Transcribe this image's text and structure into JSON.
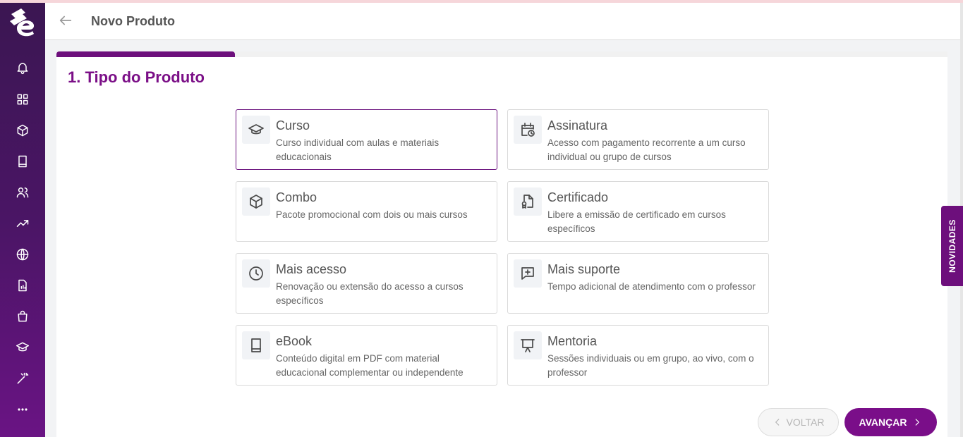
{
  "app": {
    "colors": {
      "accent": "#7a0e89",
      "sidebar": "#4a1565",
      "selected_border": "#6d1680"
    }
  },
  "sidebar": {
    "items": [
      {
        "icon": "bell-icon"
      },
      {
        "icon": "grid-icon"
      },
      {
        "icon": "box-icon"
      },
      {
        "icon": "book-icon"
      },
      {
        "icon": "users-icon"
      },
      {
        "icon": "trending-up-icon"
      },
      {
        "icon": "globe-icon"
      },
      {
        "icon": "report-icon"
      },
      {
        "icon": "shopping-bag-icon"
      },
      {
        "icon": "graduation-cap-icon"
      },
      {
        "icon": "magic-wand-icon"
      },
      {
        "icon": "more-icon"
      }
    ]
  },
  "header": {
    "title": "Novo Produto"
  },
  "wizard": {
    "progress": 0.2,
    "step_title": "1. Tipo do Produto"
  },
  "products": [
    {
      "title": "Curso",
      "description": "Curso individual com aulas e materiais educacionais",
      "icon": "graduation-cap-icon",
      "selected": true
    },
    {
      "title": "Assinatura",
      "description": "Acesso com pagamento recorrente a um curso individual ou grupo de cursos",
      "icon": "calendar-clock-icon",
      "selected": false
    },
    {
      "title": "Combo",
      "description": "Pacote promocional com dois ou mais cursos",
      "icon": "box-icon",
      "selected": false
    },
    {
      "title": "Certificado",
      "description": "Libere a emissão de certificado em cursos específicos",
      "icon": "certificate-icon",
      "selected": false
    },
    {
      "title": "Mais acesso",
      "description": "Renovação ou extensão do acesso a cursos específicos",
      "icon": "clock-icon",
      "selected": false
    },
    {
      "title": "Mais suporte",
      "description": "Tempo adicional de atendimento com o professor",
      "icon": "message-plus-icon",
      "selected": false
    },
    {
      "title": "eBook",
      "description": "Conteúdo digital em PDF com material educacional complementar ou independente",
      "icon": "book-icon",
      "selected": false
    },
    {
      "title": "Mentoria",
      "description": "Sessões individuais ou em grupo, ao vivo, com o professor",
      "icon": "presentation-icon",
      "selected": false
    }
  ],
  "actions": {
    "back_label": "VOLTAR",
    "next_label": "AVANÇAR"
  },
  "novidades": {
    "label": "NOVIDADES"
  }
}
